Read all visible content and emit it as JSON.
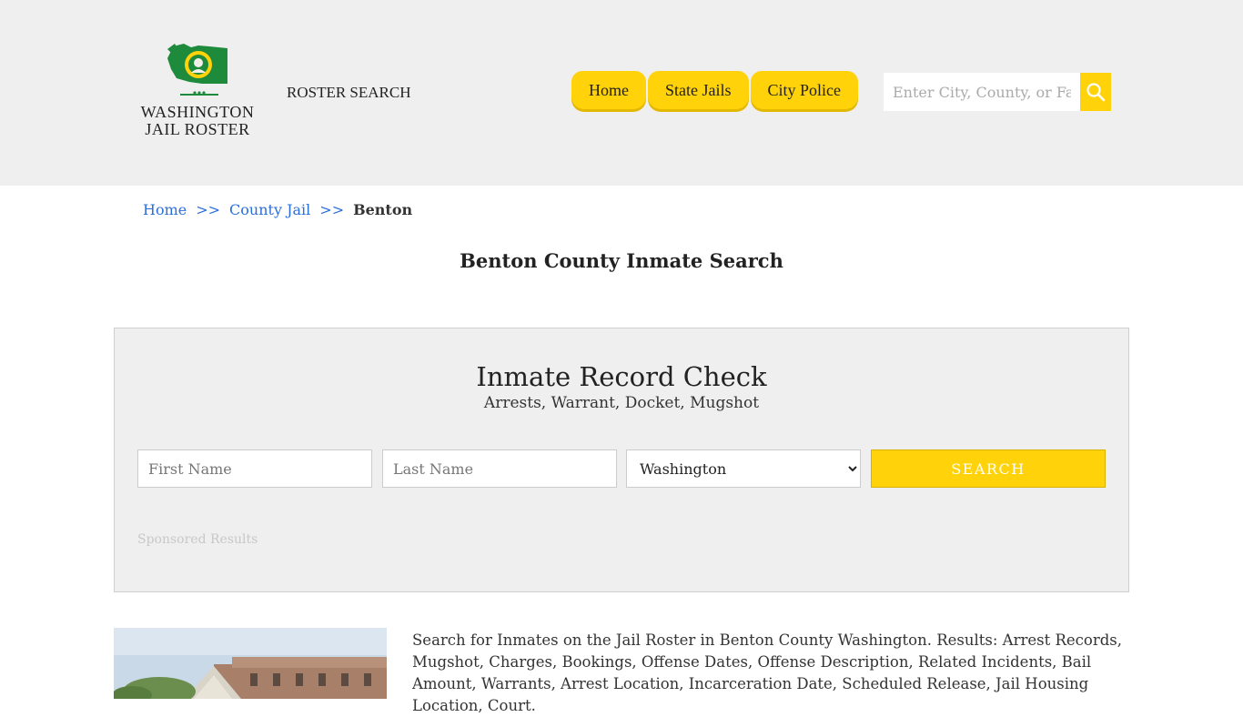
{
  "header": {
    "logo": {
      "line1": "WASHINGTON",
      "line2": "JAIL ROSTER"
    },
    "roster_search_label": "ROSTER SEARCH",
    "nav": [
      {
        "label": "Home"
      },
      {
        "label": "State Jails"
      },
      {
        "label": "City Police"
      }
    ],
    "search": {
      "placeholder": "Enter City, County, or Facility",
      "icon": "search-icon"
    },
    "colors": {
      "background": "#efefef",
      "accent": "#ffd20a",
      "flag_green": "#1e8a3c"
    }
  },
  "breadcrumb": {
    "items": [
      "Home",
      "County Jail"
    ],
    "separator": ">>",
    "current": "Benton"
  },
  "page_title": "Benton County Inmate Search",
  "record_check": {
    "title": "Inmate Record Check",
    "subtitle": "Arrests, Warrant, Docket, Mugshot",
    "first_name_placeholder": "First Name",
    "last_name_placeholder": "Last Name",
    "state_selected": "Washington",
    "search_label": "SEARCH",
    "sponsored_label": "Sponsored Results"
  },
  "description": "Search for Inmates on the Jail Roster in Benton County Washington. Results: Arrest Records, Mugshot, Charges, Bookings, Offense Dates, Offense Description, Related Incidents, Bail Amount, Warrants, Arrest Location, Incarceration Date, Scheduled Release, Jail Housing Location, Court."
}
